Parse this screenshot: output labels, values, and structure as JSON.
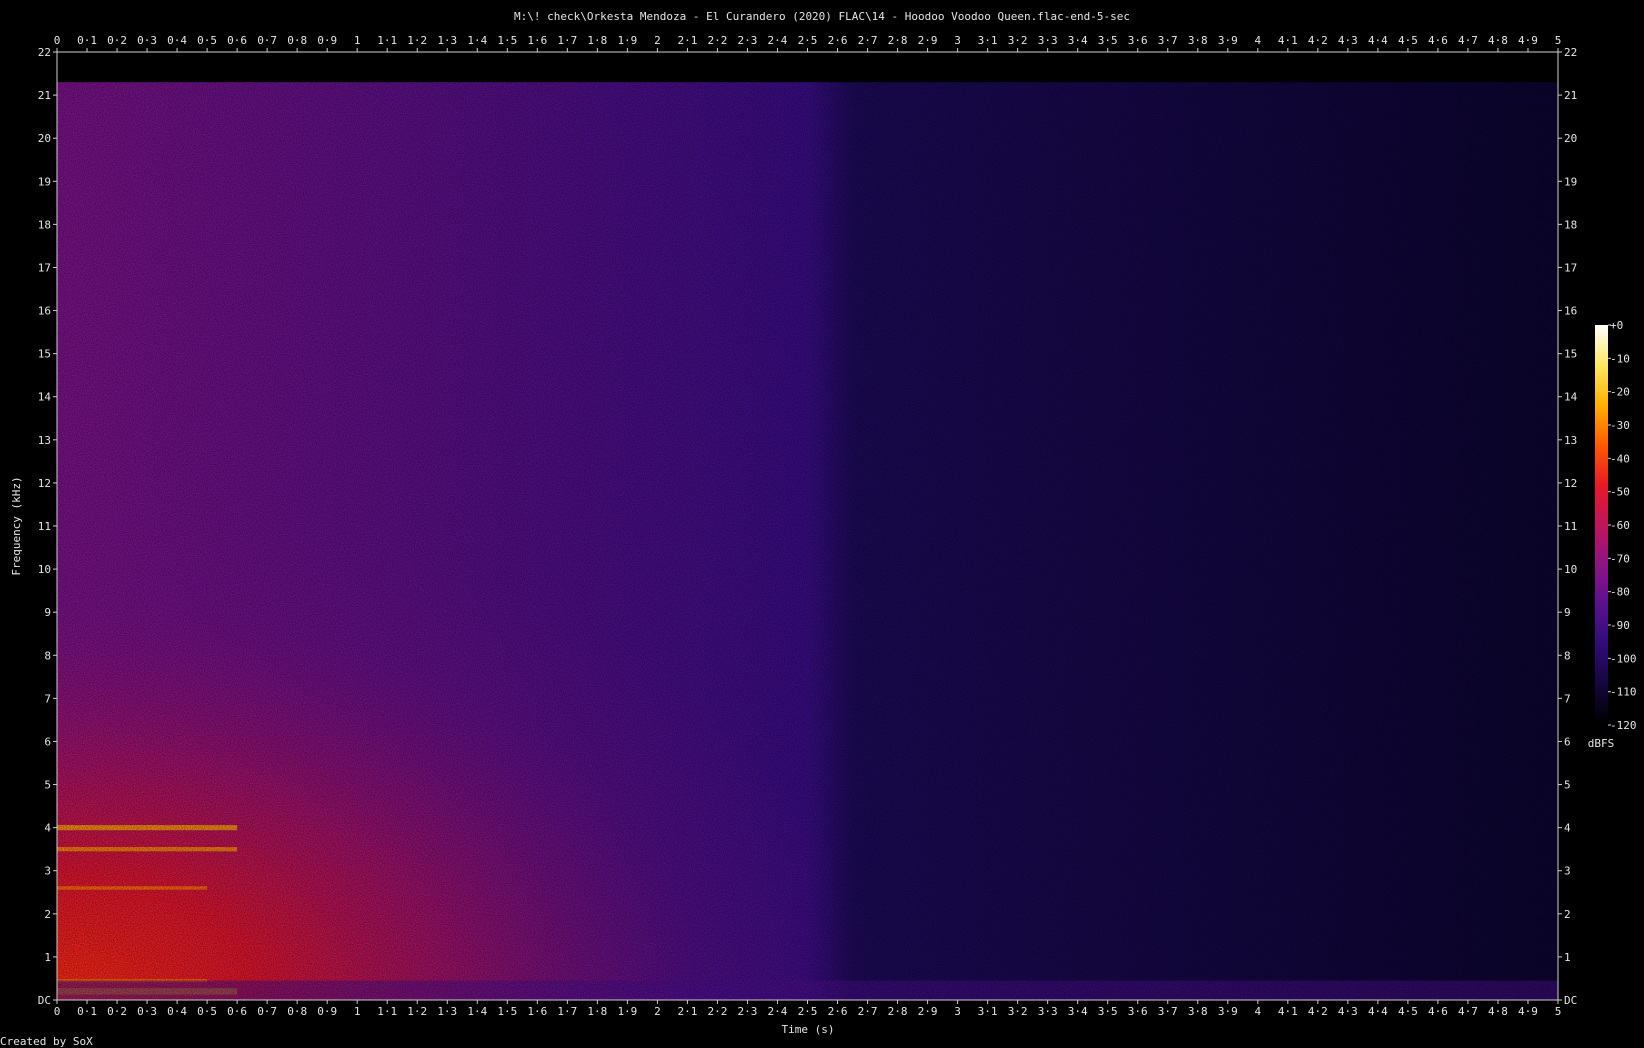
{
  "chart_data": {
    "type": "heatmap",
    "title": "M:\\! check\\Orkesta Mendoza - El Curandero (2020) FLAC\\14 - Hoodoo Voodoo Queen.flac-end-5-sec",
    "xlabel": "Time (s)",
    "ylabel": "Frequency (kHz)",
    "xlim": [
      0,
      5
    ],
    "ylim": [
      0,
      22
    ],
    "x_ticks": [
      "0",
      "0·1",
      "0·2",
      "0·3",
      "0·4",
      "0·5",
      "0·6",
      "0·7",
      "0·8",
      "0·9",
      "1",
      "1·1",
      "1·2",
      "1·3",
      "1·4",
      "1·5",
      "1·6",
      "1·7",
      "1·8",
      "1·9",
      "2",
      "2·1",
      "2·2",
      "2·3",
      "2·4",
      "2·5",
      "2·6",
      "2·7",
      "2·8",
      "2·9",
      "3",
      "3·1",
      "3·2",
      "3·3",
      "3·4",
      "3·5",
      "3·6",
      "3·7",
      "3·8",
      "3·9",
      "4",
      "4·1",
      "4·2",
      "4·3",
      "4·4",
      "4·5",
      "4·6",
      "4·7",
      "4·8",
      "4·9",
      "5"
    ],
    "y_ticks": [
      "DC",
      "1",
      "2",
      "3",
      "4",
      "5",
      "6",
      "7",
      "8",
      "9",
      "10",
      "11",
      "12",
      "13",
      "14",
      "15",
      "16",
      "17",
      "18",
      "19",
      "20",
      "21",
      "22"
    ],
    "colorbar": {
      "ticks": [
        "+0",
        "-10",
        "-20",
        "-30",
        "-40",
        "-50",
        "-60",
        "-70",
        "-80",
        "-90",
        "-100",
        "-110",
        "-120"
      ],
      "unit": "dBFS",
      "range": [
        -120,
        0
      ]
    },
    "footer": "Created by SoX",
    "colors": [
      "#000000",
      "#14063c",
      "#2f0c78",
      "#5a118f",
      "#8c1483",
      "#c0155c",
      "#e81a25",
      "#ff5a00",
      "#ffb000",
      "#ffe860",
      "#ffffff"
    ]
  }
}
